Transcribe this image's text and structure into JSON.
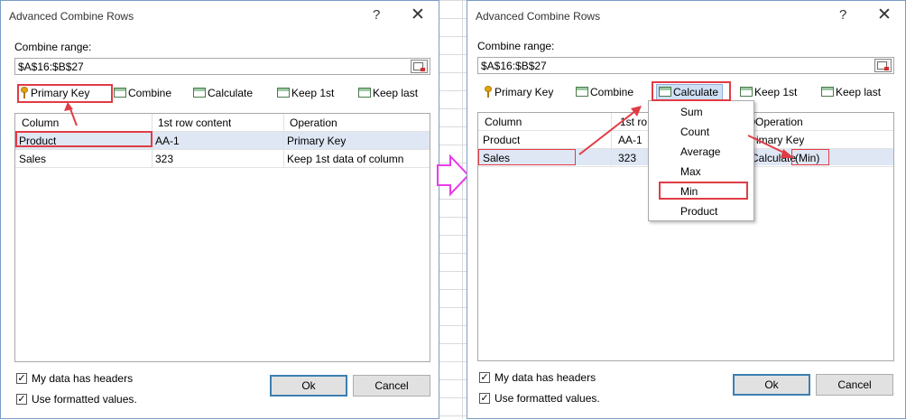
{
  "colors": {
    "annotation": "#e03c45",
    "between_arrow": "#e83ce8",
    "selected_row": "#dfe7f5",
    "default_button_border": "#3c7fb1"
  },
  "left": {
    "title": "Advanced Combine Rows",
    "help_glyph": "?",
    "close_glyph": "✕",
    "range_label": "Combine range:",
    "range_value": "$A$16:$B$27",
    "toolbar": {
      "primary_key": "Primary Key",
      "combine": "Combine",
      "calculate": "Calculate",
      "keep_first": "Keep 1st",
      "keep_last": "Keep last"
    },
    "table": {
      "headers": [
        "Column",
        "1st row content",
        "Operation"
      ],
      "rows": [
        {
          "column": "Product",
          "content": "AA-1",
          "operation": "Primary Key"
        },
        {
          "column": "Sales",
          "content": "323",
          "operation": "Keep 1st data of column"
        }
      ]
    },
    "options": {
      "has_headers": "My data has headers",
      "formatted_values": "Use formatted values."
    },
    "buttons": {
      "ok": "Ok",
      "cancel": "Cancel"
    }
  },
  "right": {
    "title": "Advanced Combine Rows",
    "help_glyph": "?",
    "close_glyph": "✕",
    "range_label": "Combine range:",
    "range_value": "$A$16:$B$27",
    "toolbar": {
      "primary_key": "Primary Key",
      "combine": "Combine",
      "calculate": "Calculate",
      "keep_first": "Keep 1st",
      "keep_last": "Keep last"
    },
    "table": {
      "headers": [
        "Column",
        "1st ro",
        "Operation"
      ],
      "header_prefix": "O",
      "rows": [
        {
          "column": "Product",
          "content": "AA-1",
          "operation": "rimary Key"
        },
        {
          "column": "Sales",
          "content": "323",
          "operation": "Calculate",
          "operation_suffix": "(Min)"
        }
      ]
    },
    "menu": [
      "Sum",
      "Count",
      "Average",
      "Max",
      "Min",
      "Product"
    ],
    "options": {
      "has_headers": "My data has headers",
      "formatted_values": "Use formatted values."
    },
    "buttons": {
      "ok": "Ok",
      "cancel": "Cancel"
    }
  }
}
